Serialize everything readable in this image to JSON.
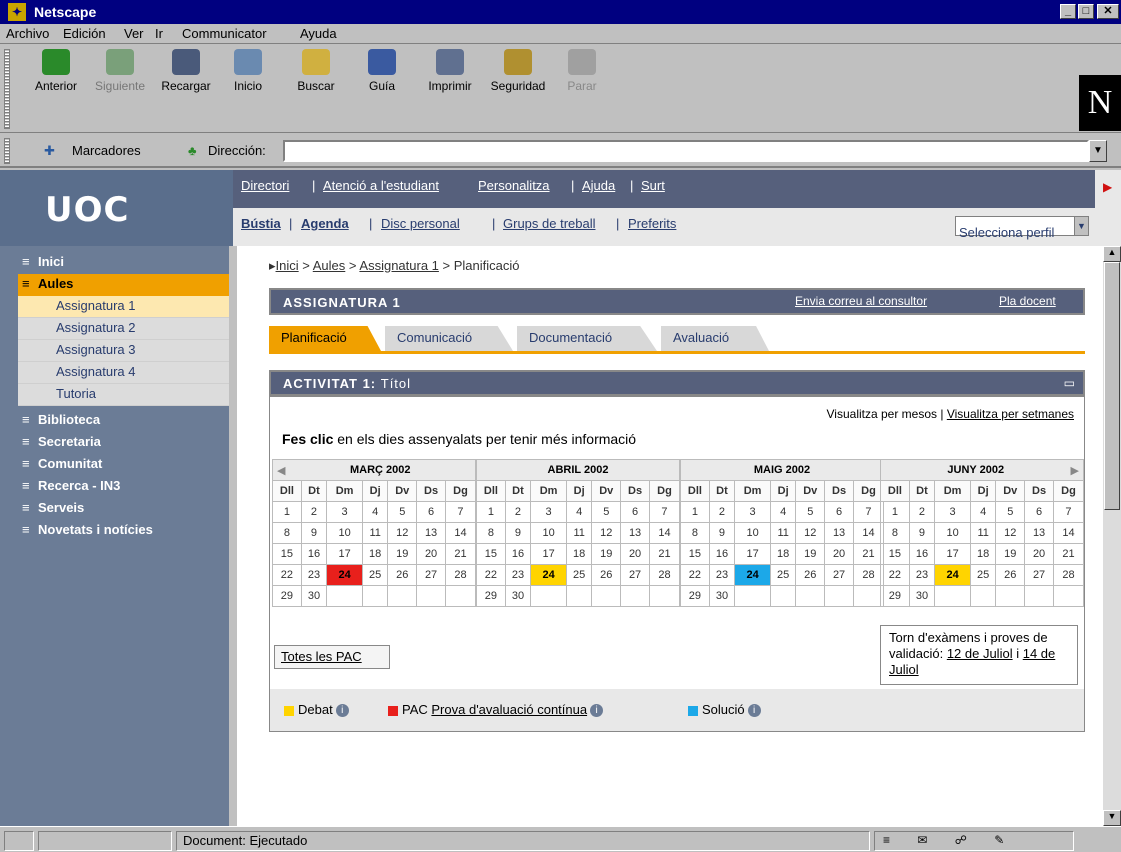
{
  "window": {
    "title": "Netscape"
  },
  "menu": [
    "Archivo",
    "Edición",
    "Ver",
    "Ir",
    "Communicator",
    "Ayuda"
  ],
  "toolbar": [
    {
      "label": "Anterior",
      "icon": "back-icon"
    },
    {
      "label": "Siguiente",
      "icon": "forward-icon"
    },
    {
      "label": "Recargar",
      "icon": "reload-icon"
    },
    {
      "label": "Inicio",
      "icon": "home-icon"
    },
    {
      "label": "Buscar",
      "icon": "search-icon"
    },
    {
      "label": "Guía",
      "icon": "guide-icon"
    },
    {
      "label": "Imprimir",
      "icon": "print-icon"
    },
    {
      "label": "Seguridad",
      "icon": "lock-icon"
    },
    {
      "label": "Parar",
      "icon": "stop-icon"
    }
  ],
  "location": {
    "bookmarks": "Marcadores",
    "direction": "Dirección:",
    "value": ""
  },
  "uoc": {
    "logo": "UOC"
  },
  "topnav": [
    "Directori",
    "Atenció a l'estudiant",
    "Personalitza",
    "Ajuda",
    "Surt"
  ],
  "subnav": [
    "Bústia",
    "Agenda",
    "Disc personal",
    "Grups de treball",
    "Preferits"
  ],
  "perfil": "Selecciona perfil",
  "sidebar": {
    "items": [
      "Inici",
      "Aules",
      "Biblioteca",
      "Secretaria",
      "Comunitat",
      "Recerca - IN3",
      "Serveis",
      "Novetats i notícies"
    ],
    "subitems": [
      "Assignatura 1",
      "Assignatura 2",
      "Assignatura 3",
      "Assignatura 4",
      "Tutoria"
    ]
  },
  "breadcrumb": {
    "items": [
      "Inici",
      "Aules",
      "Assignatura 1"
    ],
    "current": "Planificació"
  },
  "assignatura": {
    "title": "ASSIGNATURA 1",
    "link1": "Envia correu al consultor",
    "link2": "Pla docent"
  },
  "tabs": [
    "Planificació",
    "Comunicació",
    "Documentació",
    "Avaluació"
  ],
  "activitat": {
    "title": "ACTIVITAT 1:",
    "subtitle": "Títol"
  },
  "view": {
    "months": "Visualitza per mesos",
    "weeks": "Visualitza per setmanes"
  },
  "instruction": {
    "bold": "Fes clic",
    "rest": " en els dies assenyalats per tenir més informació"
  },
  "days": [
    "Dll",
    "Dt",
    "Dm",
    "Dj",
    "Dv",
    "Ds",
    "Dg"
  ],
  "calendars": [
    {
      "month": "MARÇ 2002",
      "prev": "◀",
      "next": "",
      "weeks": [
        [
          "1",
          "2",
          "3",
          "4",
          "5",
          "6",
          "7"
        ],
        [
          "8",
          "9",
          "10",
          "11",
          "12",
          "13",
          "14"
        ],
        [
          "15",
          "16",
          "17",
          "18",
          "19",
          "20",
          "21"
        ],
        [
          "22",
          "23",
          "24",
          "25",
          "26",
          "27",
          "28"
        ],
        [
          "29",
          "30",
          "",
          "",
          "",
          "",
          ""
        ]
      ],
      "mark": {
        "day": "24",
        "color": "#e8201c"
      }
    },
    {
      "month": "ABRIL 2002",
      "prev": "",
      "next": "",
      "weeks": [
        [
          "1",
          "2",
          "3",
          "4",
          "5",
          "6",
          "7"
        ],
        [
          "8",
          "9",
          "10",
          "11",
          "12",
          "13",
          "14"
        ],
        [
          "15",
          "16",
          "17",
          "18",
          "19",
          "20",
          "21"
        ],
        [
          "22",
          "23",
          "24",
          "25",
          "26",
          "27",
          "28"
        ],
        [
          "29",
          "30",
          "",
          "",
          "",
          "",
          ""
        ]
      ],
      "mark": {
        "day": "24",
        "color": "#ffd400"
      }
    },
    {
      "month": "MAIG 2002",
      "prev": "",
      "next": "",
      "weeks": [
        [
          "1",
          "2",
          "3",
          "4",
          "5",
          "6",
          "7"
        ],
        [
          "8",
          "9",
          "10",
          "11",
          "12",
          "13",
          "14"
        ],
        [
          "15",
          "16",
          "17",
          "18",
          "19",
          "20",
          "21"
        ],
        [
          "22",
          "23",
          "24",
          "25",
          "26",
          "27",
          "28"
        ],
        [
          "29",
          "30",
          "",
          "",
          "",
          "",
          ""
        ]
      ],
      "mark": {
        "day": "24",
        "color": "#1ca8e8"
      }
    },
    {
      "month": "JUNY 2002",
      "prev": "",
      "next": "▶",
      "weeks": [
        [
          "1",
          "2",
          "3",
          "4",
          "5",
          "6",
          "7"
        ],
        [
          "8",
          "9",
          "10",
          "11",
          "12",
          "13",
          "14"
        ],
        [
          "15",
          "16",
          "17",
          "18",
          "19",
          "20",
          "21"
        ],
        [
          "22",
          "23",
          "24",
          "25",
          "26",
          "27",
          "28"
        ],
        [
          "29",
          "30",
          "",
          "",
          "",
          "",
          ""
        ]
      ],
      "mark": {
        "day": "24",
        "color": "#ffd400"
      }
    }
  ],
  "exams": {
    "text": "Torn d'exàmens i proves de validació: ",
    "date1": "12 de Juliol",
    "mid": " i ",
    "date2": "14 de Juliol"
  },
  "pac_button": "Totes les PAC",
  "legend": {
    "debat": "Debat",
    "pac": "PAC",
    "pac_link": "Prova d'avaluació contínua",
    "solucio": "Solució"
  },
  "status": {
    "text": "Document: Ejecutado"
  },
  "colors": {
    "debat": "#ffd400",
    "pac": "#e8201c",
    "solucio": "#1ca8e8",
    "accent": "#f0a000",
    "header": "#56607c"
  }
}
